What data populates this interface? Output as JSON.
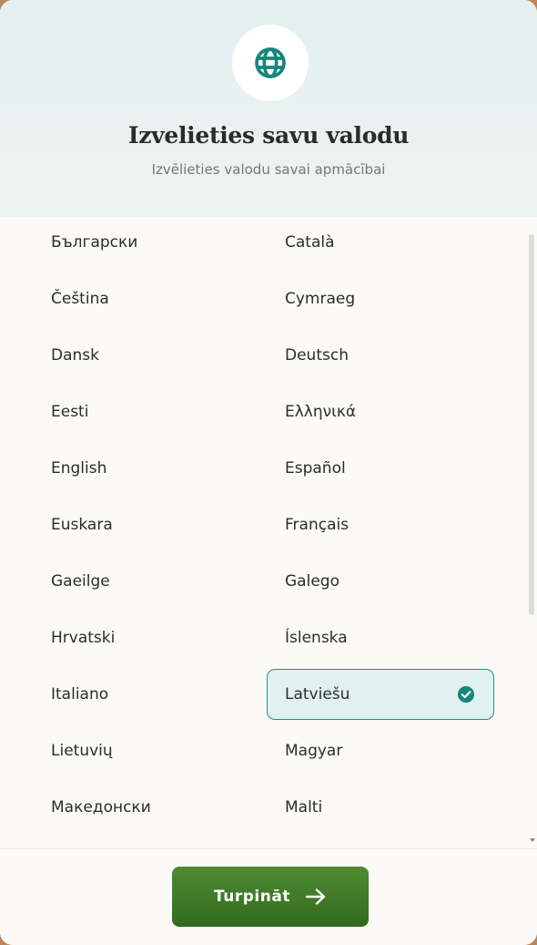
{
  "header": {
    "icon": "globe-icon",
    "title": "Izvelieties savu valodu",
    "subtitle": "Izvēlieties valodu savai apmācībai"
  },
  "languages": {
    "left": [
      "Български",
      "Čeština",
      "Dansk",
      "Eesti",
      "English",
      "Euskara",
      "Gaeilge",
      "Hrvatski",
      "Italiano",
      "Lietuvių",
      "Македонски"
    ],
    "right": [
      "Català",
      "Cymraeg",
      "Deutsch",
      "Ελληνικά",
      "Español",
      "Français",
      "Galego",
      "Íslenska",
      "Latviešu",
      "Magyar",
      "Malti"
    ],
    "selected": "Latviešu"
  },
  "footer": {
    "continue_label": "Turpināt",
    "continue_icon": "arrow-right-icon"
  },
  "colors": {
    "accent": "#2a8f86",
    "selected_bg": "#e0f1ef",
    "button": "#3d7a26"
  }
}
